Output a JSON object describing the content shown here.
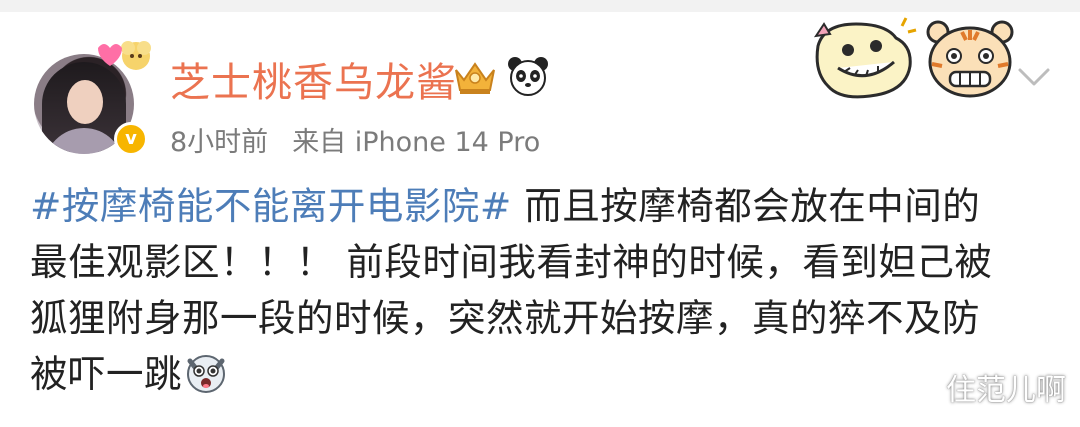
{
  "post": {
    "username": "芝士桃香乌龙酱",
    "time": "8小时前",
    "source": "来自 iPhone 14 Pro",
    "hashtag": "#按摩椅能不能离开电影院#",
    "text_lines": [
      " 而且按摩椅都会放在中间的",
      "最佳观影区！！！ 前段时间我看封神的时候，看到妲己被",
      "狐狸附身那一段的时候，突然就开始按摩，真的猝不及防",
      "被吓一跳"
    ]
  },
  "watermark": "住范儿啊",
  "colors": {
    "username": "#eb7350",
    "hashtag": "#4d7db8",
    "meta": "#7b7b7b",
    "verified": "#f7b500"
  },
  "icons": [
    "avatar",
    "verified-badge-icon",
    "crown-icon",
    "panda-icon",
    "dragon-sticker",
    "tiger-sticker",
    "chevron-down-icon",
    "dog-emoji-icon"
  ]
}
